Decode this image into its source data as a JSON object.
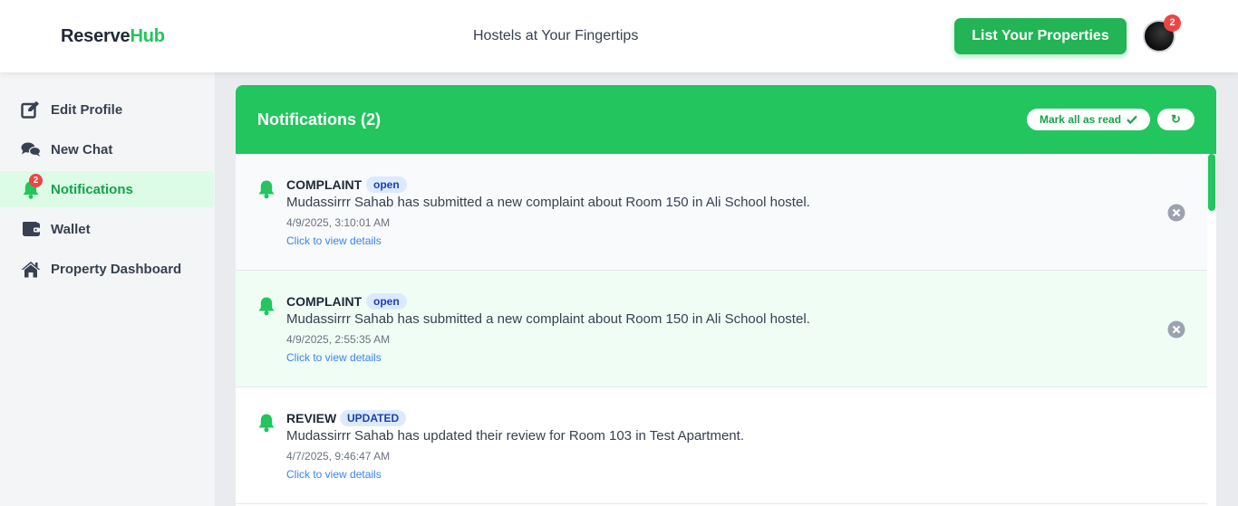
{
  "header": {
    "logo_part1": "Reserve",
    "logo_part2": "Hub",
    "tagline": "Hostels at Your Fingertips",
    "list_button": "List Your Properties",
    "avatar_badge": "2"
  },
  "sidebar": {
    "items": [
      {
        "label": "Edit Profile",
        "icon": "edit-icon"
      },
      {
        "label": "New Chat",
        "icon": "chat-icon"
      },
      {
        "label": "Notifications",
        "icon": "bell-icon",
        "badge": "2",
        "active": true
      },
      {
        "label": "Wallet",
        "icon": "wallet-icon"
      },
      {
        "label": "Property Dashboard",
        "icon": "home-icon"
      }
    ]
  },
  "notifications_panel": {
    "title": "Notifications (2)",
    "mark_all_label": "Mark all as read",
    "refresh_symbol": "↻",
    "items": [
      {
        "type": "COMPLAINT",
        "status": "open",
        "message": "Mudassirrr Sahab has submitted a new complaint about Room 150 in Ali School hostel.",
        "time": "4/9/2025, 3:10:01 AM",
        "link": "Click to view details"
      },
      {
        "type": "COMPLAINT",
        "status": "open",
        "message": "Mudassirrr Sahab has submitted a new complaint about Room 150 in Ali School hostel.",
        "time": "4/9/2025, 2:55:35 AM",
        "link": "Click to view details"
      },
      {
        "type": "REVIEW",
        "status": "UPDATED",
        "message": "Mudassirrr Sahab has updated their review for Room 103 in Test Apartment.",
        "time": "4/7/2025, 9:46:47 AM",
        "link": "Click to view details"
      }
    ]
  },
  "colors": {
    "brand_green": "#22c55e",
    "badge_red": "#ef4444",
    "status_badge_bg": "#dbeafe",
    "status_badge_text": "#1e40af",
    "link_blue": "#3b82f6"
  }
}
